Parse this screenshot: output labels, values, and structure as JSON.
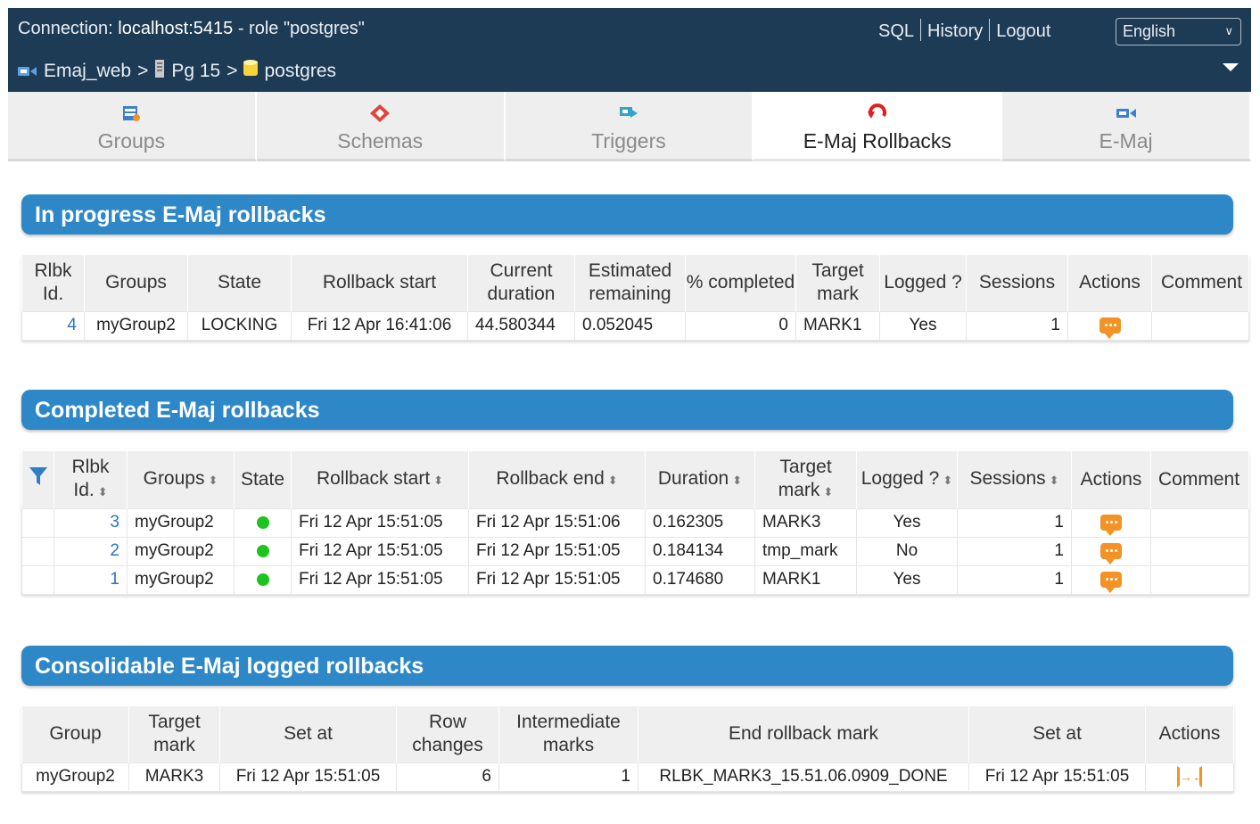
{
  "header": {
    "conn_prefix": "Connection: ",
    "conn_host": "localhost:5415",
    "conn_role": " - role \"postgres\"",
    "links": {
      "sql": "SQL",
      "history": "History",
      "logout": "Logout"
    },
    "language": "English",
    "breadcrumb": {
      "app": "Emaj_web",
      "server": "Pg 15",
      "database": "postgres",
      "separator": ">"
    }
  },
  "tabs": [
    {
      "label": "Groups",
      "icon": "groups-icon"
    },
    {
      "label": "Schemas",
      "icon": "schemas-icon"
    },
    {
      "label": "Triggers",
      "icon": "triggers-icon"
    },
    {
      "label": "E-Maj Rollbacks",
      "icon": "rollback-icon",
      "active": true
    },
    {
      "label": "E-Maj",
      "icon": "emaj-icon"
    }
  ],
  "in_progress": {
    "title": "In progress E-Maj rollbacks",
    "columns": [
      "Rlbk Id.",
      "Groups",
      "State",
      "Rollback start",
      "Current duration",
      "Estimated remaining",
      "% completed",
      "Target mark",
      "Logged ?",
      "Sessions",
      "Actions",
      "Comment"
    ],
    "rows": [
      {
        "id": "4",
        "groups": "myGroup2",
        "state": "LOCKING",
        "start": "Fri 12 Apr 16:41:06",
        "duration": "44.580344",
        "remaining": "0.052045",
        "completed": "0",
        "mark": "MARK1",
        "logged": "Yes",
        "sessions": "1"
      }
    ]
  },
  "completed": {
    "title": "Completed E-Maj rollbacks",
    "columns": [
      "Rlbk Id.",
      "Groups",
      "State",
      "Rollback start",
      "Rollback end",
      "Duration",
      "Target mark",
      "Logged ?",
      "Sessions",
      "Actions",
      "Comment"
    ],
    "rows": [
      {
        "id": "3",
        "groups": "myGroup2",
        "start": "Fri 12 Apr 15:51:05",
        "end": "Fri 12 Apr 15:51:06",
        "duration": "0.162305",
        "mark": "MARK3",
        "logged": "Yes",
        "sessions": "1"
      },
      {
        "id": "2",
        "groups": "myGroup2",
        "start": "Fri 12 Apr 15:51:05",
        "end": "Fri 12 Apr 15:51:05",
        "duration": "0.184134",
        "mark": "tmp_mark",
        "logged": "No",
        "sessions": "1"
      },
      {
        "id": "1",
        "groups": "myGroup2",
        "start": "Fri 12 Apr 15:51:05",
        "end": "Fri 12 Apr 15:51:05",
        "duration": "0.174680",
        "mark": "MARK1",
        "logged": "Yes",
        "sessions": "1"
      }
    ],
    "state_color": "#1dc41d"
  },
  "consolidable": {
    "title": "Consolidable E-Maj logged rollbacks",
    "columns": [
      "Group",
      "Target mark",
      "Set at",
      "Row changes",
      "Intermediate marks",
      "End rollback mark",
      "Set at",
      "Actions"
    ],
    "rows": [
      {
        "group": "myGroup2",
        "mark": "MARK3",
        "set_at": "Fri 12 Apr 15:51:05",
        "row_changes": "6",
        "intermediate": "1",
        "end_mark": "RLBK_MARK3_15.51.06.0909_DONE",
        "end_set_at": "Fri 12 Apr 15:51:05"
      }
    ]
  },
  "colors": {
    "header_bg": "#1e3b55",
    "section_bg": "#2e88c8",
    "action_orange": "#f39325",
    "link_blue": "#2b73c8"
  }
}
